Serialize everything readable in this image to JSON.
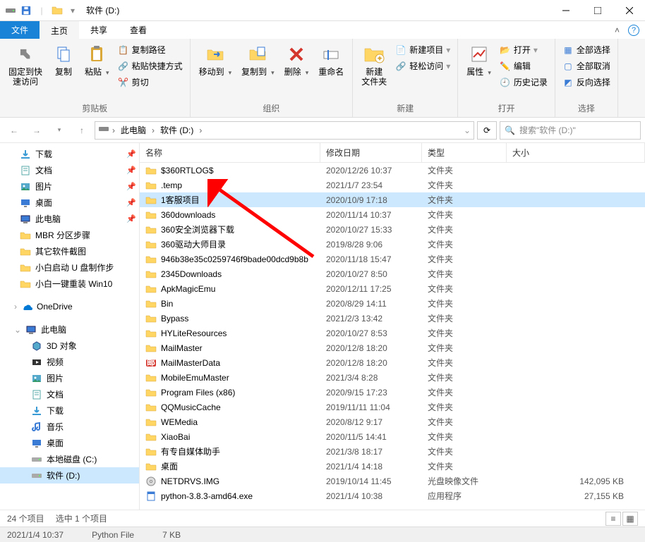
{
  "window": {
    "title": "软件 (D:)"
  },
  "qat": {
    "separator": "|"
  },
  "tabs": {
    "file": "文件",
    "home": "主页",
    "share": "共享",
    "view": "查看"
  },
  "ribbon": {
    "clipboard": {
      "label": "剪贴板",
      "pin": "固定到快\n速访问",
      "copy": "复制",
      "paste": "粘贴",
      "copypath": "复制路径",
      "pasteshortcut": "粘贴快捷方式",
      "cut": "剪切"
    },
    "organize": {
      "label": "组织",
      "moveto": "移动到",
      "copyto": "复制到",
      "delete": "删除",
      "rename": "重命名"
    },
    "new": {
      "label": "新建",
      "newfolder": "新建\n文件夹",
      "newitem": "新建项目",
      "easyaccess": "轻松访问"
    },
    "open": {
      "label": "打开",
      "properties": "属性",
      "open": "打开",
      "edit": "编辑",
      "history": "历史记录"
    },
    "select": {
      "label": "选择",
      "selectall": "全部选择",
      "selectnone": "全部取消",
      "invert": "反向选择"
    }
  },
  "breadcrumb": {
    "root": "此电脑",
    "drive": "软件 (D:)"
  },
  "search": {
    "placeholder": "搜索\"软件 (D:)\""
  },
  "columns": {
    "name": "名称",
    "date": "修改日期",
    "type": "类型",
    "size": "大小"
  },
  "sidebar": {
    "items": [
      {
        "label": "下载",
        "icon": "download",
        "pin": true
      },
      {
        "label": "文档",
        "icon": "document",
        "pin": true
      },
      {
        "label": "图片",
        "icon": "picture",
        "pin": true
      },
      {
        "label": "桌面",
        "icon": "desktop",
        "pin": true
      },
      {
        "label": "此电脑",
        "icon": "pc",
        "pin": true
      },
      {
        "label": "MBR 分区步骤",
        "icon": "folder",
        "pin": false
      },
      {
        "label": "其它软件截图",
        "icon": "folder",
        "pin": false
      },
      {
        "label": "小白启动 U 盘制作步",
        "icon": "folder",
        "pin": false
      },
      {
        "label": "小白一键重装 Win10",
        "icon": "folder",
        "pin": false
      }
    ],
    "onedrive": "OneDrive",
    "thispc": "此电脑",
    "pc_items": [
      {
        "label": "3D 对象",
        "icon": "3d"
      },
      {
        "label": "视频",
        "icon": "video"
      },
      {
        "label": "图片",
        "icon": "picture"
      },
      {
        "label": "文档",
        "icon": "document"
      },
      {
        "label": "下载",
        "icon": "download"
      },
      {
        "label": "音乐",
        "icon": "music"
      },
      {
        "label": "桌面",
        "icon": "desktop"
      },
      {
        "label": "本地磁盘 (C:)",
        "icon": "drive"
      },
      {
        "label": "软件 (D:)",
        "icon": "drive",
        "selected": true
      }
    ]
  },
  "files": [
    {
      "name": "$360RTLOG$",
      "date": "2020/12/26 10:37",
      "type": "文件夹",
      "size": "",
      "icon": "folder"
    },
    {
      "name": ".temp",
      "date": "2021/1/7 23:54",
      "type": "文件夹",
      "size": "",
      "icon": "folder"
    },
    {
      "name": "1客服项目",
      "date": "2020/10/9 17:18",
      "type": "文件夹",
      "size": "",
      "icon": "folder",
      "selected": true
    },
    {
      "name": "360downloads",
      "date": "2020/11/14 10:37",
      "type": "文件夹",
      "size": "",
      "icon": "folder"
    },
    {
      "name": "360安全浏览器下载",
      "date": "2020/10/27 15:33",
      "type": "文件夹",
      "size": "",
      "icon": "folder"
    },
    {
      "name": "360驱动大师目录",
      "date": "2019/8/28 9:06",
      "type": "文件夹",
      "size": "",
      "icon": "folder"
    },
    {
      "name": "946b38e35c0259746f9bade00dcd9b8b",
      "date": "2020/11/18 15:47",
      "type": "文件夹",
      "size": "",
      "icon": "folder"
    },
    {
      "name": "2345Downloads",
      "date": "2020/10/27 8:50",
      "type": "文件夹",
      "size": "",
      "icon": "folder"
    },
    {
      "name": "ApkMagicEmu",
      "date": "2020/12/11 17:25",
      "type": "文件夹",
      "size": "",
      "icon": "folder"
    },
    {
      "name": "Bin",
      "date": "2020/8/29 14:11",
      "type": "文件夹",
      "size": "",
      "icon": "folder"
    },
    {
      "name": "Bypass",
      "date": "2021/2/3 13:42",
      "type": "文件夹",
      "size": "",
      "icon": "folder"
    },
    {
      "name": "HYLiteResources",
      "date": "2020/10/27 8:53",
      "type": "文件夹",
      "size": "",
      "icon": "folder"
    },
    {
      "name": "MailMaster",
      "date": "2020/12/8 18:20",
      "type": "文件夹",
      "size": "",
      "icon": "folder"
    },
    {
      "name": "MailMasterData",
      "date": "2020/12/8 18:20",
      "type": "文件夹",
      "size": "",
      "icon": "mail"
    },
    {
      "name": "MobileEmuMaster",
      "date": "2021/3/4 8:28",
      "type": "文件夹",
      "size": "",
      "icon": "folder"
    },
    {
      "name": "Program Files (x86)",
      "date": "2020/9/15 17:23",
      "type": "文件夹",
      "size": "",
      "icon": "folder"
    },
    {
      "name": "QQMusicCache",
      "date": "2019/11/11 11:04",
      "type": "文件夹",
      "size": "",
      "icon": "folder"
    },
    {
      "name": "WEMedia",
      "date": "2020/8/12 9:17",
      "type": "文件夹",
      "size": "",
      "icon": "folder"
    },
    {
      "name": "XiaoBai",
      "date": "2020/11/5 14:41",
      "type": "文件夹",
      "size": "",
      "icon": "folder"
    },
    {
      "name": "有专自媒体助手",
      "date": "2021/3/8 18:17",
      "type": "文件夹",
      "size": "",
      "icon": "folder"
    },
    {
      "name": "桌面",
      "date": "2021/1/4 14:18",
      "type": "文件夹",
      "size": "",
      "icon": "folder"
    },
    {
      "name": "NETDRVS.IMG",
      "date": "2019/10/14 11:45",
      "type": "光盘映像文件",
      "size": "142,095 KB",
      "icon": "disc"
    },
    {
      "name": "python-3.8.3-amd64.exe",
      "date": "2021/1/4 10:38",
      "type": "应用程序",
      "size": "27,155 KB",
      "icon": "exe"
    }
  ],
  "status": {
    "count": "24 个项目",
    "selected": "选中 1 个项目"
  },
  "bottombar": {
    "date": "2021/1/4 10:37",
    "type": "Python File",
    "size": "7 KB"
  }
}
